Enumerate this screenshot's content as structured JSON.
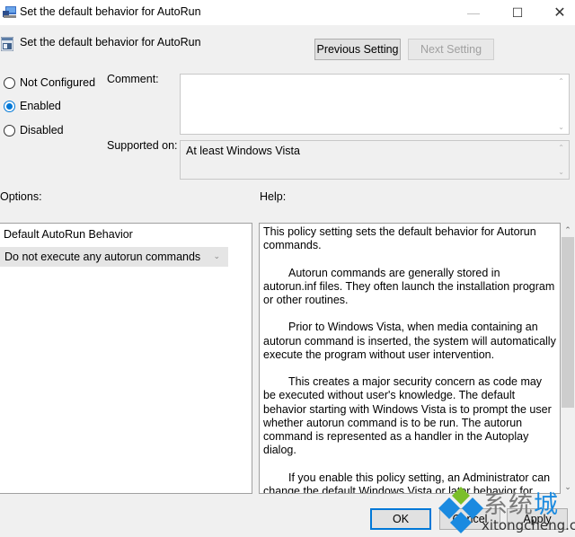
{
  "window": {
    "title": "Set the default behavior for AutoRun",
    "controls": {
      "minimize": "—",
      "maximize": "☐",
      "close": "✕"
    }
  },
  "header": {
    "title": "Set the default behavior for AutoRun",
    "previous_label": "Previous Setting",
    "next_label": "Next Setting",
    "next_disabled": true
  },
  "state": {
    "options": [
      {
        "label": "Not Configured",
        "checked": false
      },
      {
        "label": "Enabled",
        "checked": true
      },
      {
        "label": "Disabled",
        "checked": false
      }
    ]
  },
  "comment": {
    "label": "Comment:",
    "value": ""
  },
  "supported": {
    "label": "Supported on:",
    "value": "At least Windows Vista"
  },
  "options_section": {
    "label": "Options:",
    "setting_label": "Default AutoRun Behavior",
    "dropdown_value": "Do not execute any autorun commands"
  },
  "help_section": {
    "label": "Help:",
    "paragraphs": [
      "This policy setting sets the default behavior for Autorun commands.",
      "Autorun commands are generally stored in autorun.inf files. They often launch the installation program or other routines.",
      "Prior to Windows Vista, when media containing an autorun command is inserted, the system will automatically execute the program without user intervention.",
      "This creates a major security concern as code may be executed without user's knowledge. The default behavior starting with Windows Vista is to prompt the user whether autorun command is to be run. The autorun command is represented as a handler in the Autoplay dialog.",
      "If you enable this policy setting, an Administrator can change the default Windows Vista or later behavior for autorun to:"
    ]
  },
  "footer": {
    "ok": "OK",
    "cancel": "Cancel",
    "apply": "Apply"
  },
  "watermark": {
    "chinese": "系统城",
    "url": "xitongcheng.com"
  },
  "colors": {
    "accent": "#0078d7",
    "background": "#f0f0f0"
  }
}
